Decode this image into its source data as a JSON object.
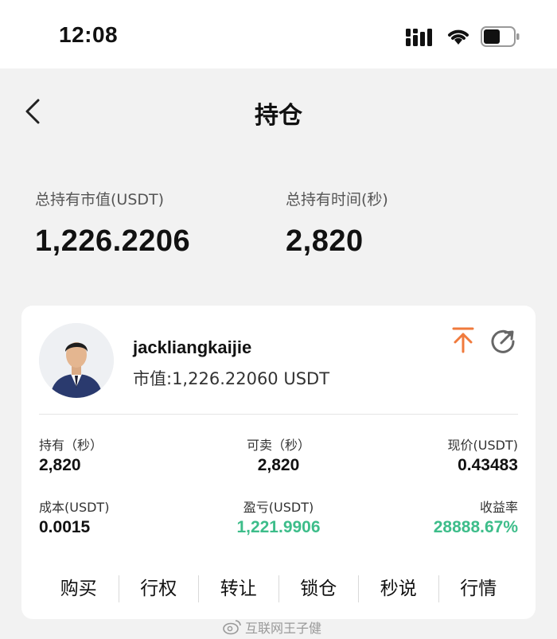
{
  "status_bar": {
    "time": "12:08"
  },
  "header": {
    "title": "持仓"
  },
  "summary": {
    "total_value_label": "总持有市值(USDT)",
    "total_value": "1,226.2206",
    "total_time_label": "总持有时间(秒)",
    "total_time": "2,820"
  },
  "card": {
    "username": "jackliangkaijie",
    "market_value_text": "市值:1,226.22060 USDT",
    "stats": {
      "hold_label": "持有（秒）",
      "hold_value": "2,820",
      "sellable_label": "可卖（秒）",
      "sellable_value": "2,820",
      "price_label": "现价(USDT)",
      "price_value": "0.43483",
      "cost_label": "成本(USDT)",
      "cost_value": "0.0015",
      "pnl_label": "盈亏(USDT)",
      "pnl_value": "1,221.9906",
      "yield_label": "收益率",
      "yield_value": "28888.67%"
    },
    "actions": [
      "购买",
      "行权",
      "转让",
      "锁仓",
      "秒说",
      "行情"
    ]
  },
  "watermark": {
    "text": "互联网王子健"
  },
  "colors": {
    "accent_orange": "#f07a3c",
    "profit_green": "#3dbd8a"
  },
  "icons": [
    "signal-icon",
    "wifi-icon",
    "battery-icon",
    "back-icon",
    "pin-top-icon",
    "refresh-icon",
    "weibo-icon"
  ]
}
